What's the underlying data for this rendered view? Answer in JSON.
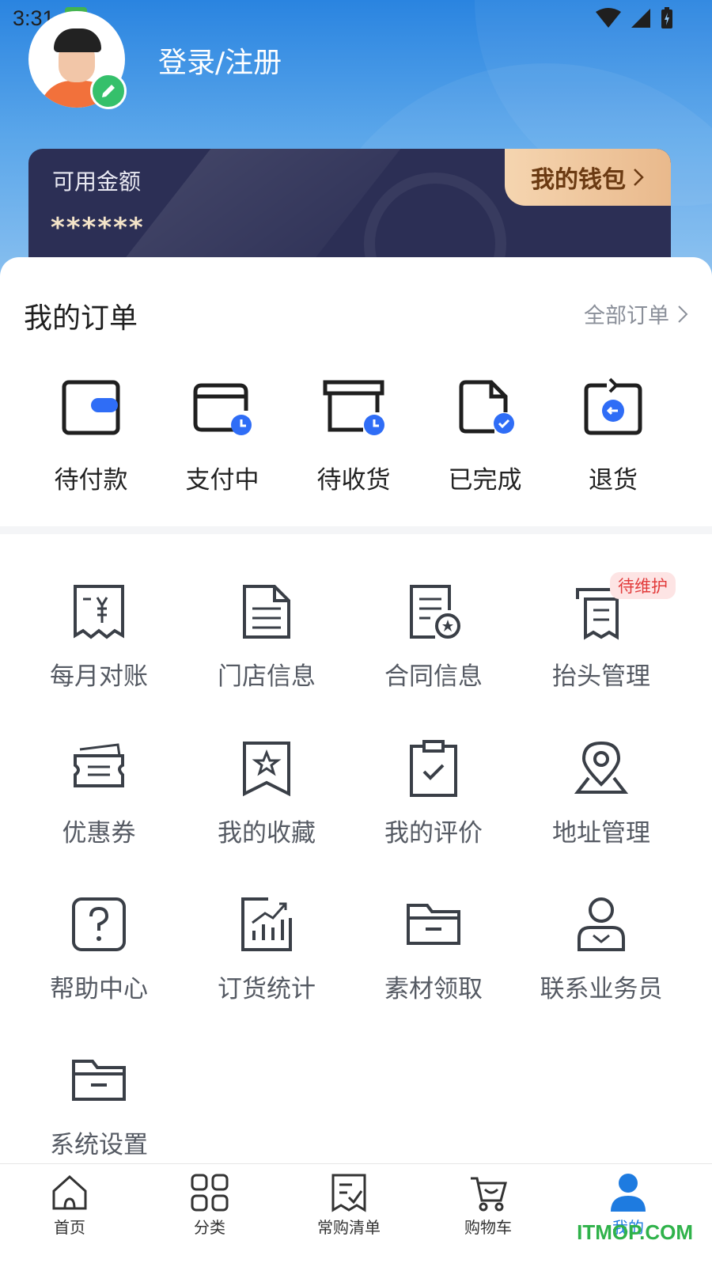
{
  "status_bar": {
    "time": "3:31",
    "icons": [
      "app-notification-icon",
      "wifi-icon",
      "signal-icon",
      "battery-icon"
    ]
  },
  "profile": {
    "login_label": "登录/注册",
    "avatar_icon": "avatar-icon",
    "edit_icon": "pencil-icon"
  },
  "wallet": {
    "available_label": "可用金额",
    "balance": "******",
    "button_label": "我的钱包"
  },
  "orders": {
    "title": "我的订单",
    "all_label": "全部订单",
    "items": [
      {
        "label": "待付款",
        "icon": "wallet-pending-icon"
      },
      {
        "label": "支付中",
        "icon": "card-clock-icon"
      },
      {
        "label": "待收货",
        "icon": "box-clock-icon"
      },
      {
        "label": "已完成",
        "icon": "document-check-icon"
      },
      {
        "label": "退货",
        "icon": "return-icon"
      }
    ]
  },
  "services": [
    {
      "label": "每月对账",
      "icon": "receipt-yen-icon"
    },
    {
      "label": "门店信息",
      "icon": "document-icon"
    },
    {
      "label": "合同信息",
      "icon": "contract-star-icon"
    },
    {
      "label": "抬头管理",
      "icon": "invoice-title-icon",
      "badge": "待维护"
    },
    {
      "label": "优惠券",
      "icon": "coupon-icon"
    },
    {
      "label": "我的收藏",
      "icon": "bookmark-star-icon"
    },
    {
      "label": "我的评价",
      "icon": "clipboard-check-icon"
    },
    {
      "label": "地址管理",
      "icon": "location-pin-icon"
    },
    {
      "label": "帮助中心",
      "icon": "question-icon"
    },
    {
      "label": "订货统计",
      "icon": "chart-icon"
    },
    {
      "label": "素材领取",
      "icon": "folder-icon"
    },
    {
      "label": "联系业务员",
      "icon": "user-contact-icon"
    },
    {
      "label": "系统设置",
      "icon": "settings-folder-icon"
    }
  ],
  "tabbar": {
    "items": [
      {
        "label": "首页",
        "icon": "home-icon"
      },
      {
        "label": "分类",
        "icon": "category-icon"
      },
      {
        "label": "常购清单",
        "icon": "list-icon"
      },
      {
        "label": "购物车",
        "icon": "cart-icon"
      },
      {
        "label": "我的",
        "icon": "user-icon",
        "active": true
      }
    ]
  },
  "watermark": "ITMOP.COM",
  "colors": {
    "primary": "#1e7be0",
    "wallet_bg": "#2c2f55",
    "wallet_button": "#f5d5b0",
    "badge_bg": "#fde4e4",
    "badge_text": "#e23b3b"
  }
}
